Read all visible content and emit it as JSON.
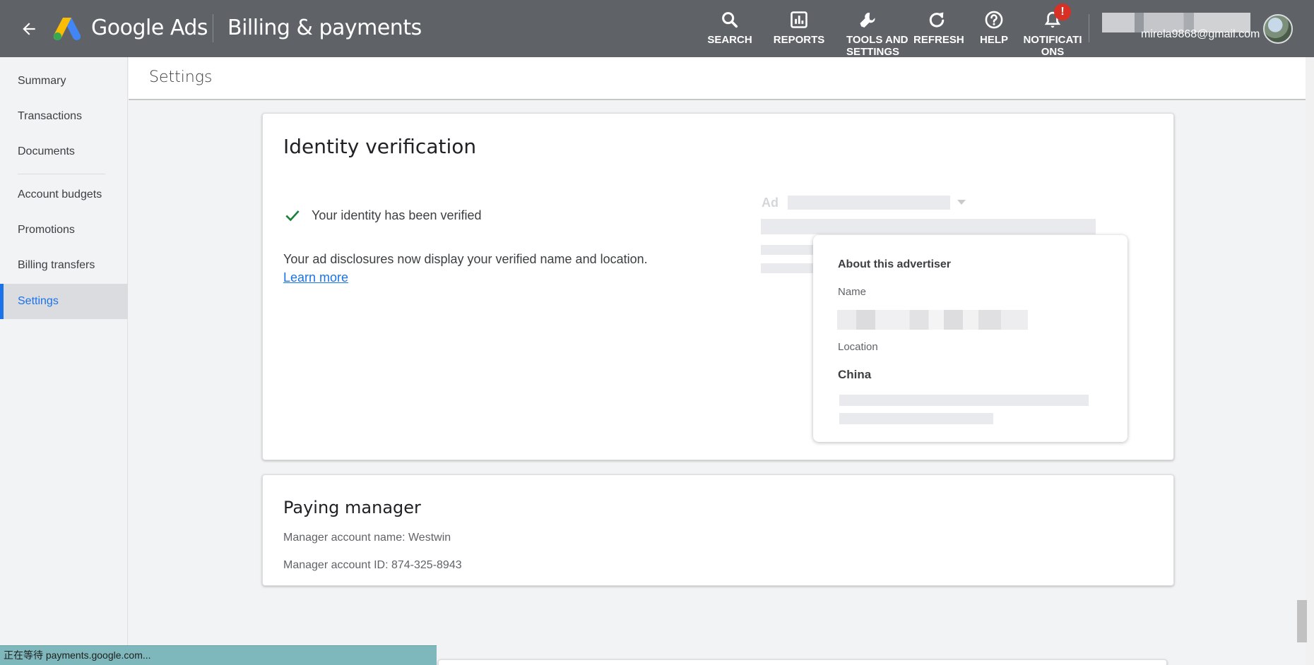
{
  "header": {
    "brand": "Google Ads",
    "section": "Billing & payments",
    "tools": [
      {
        "label": "SEARCH",
        "icon": "search-icon"
      },
      {
        "label": "REPORTS",
        "icon": "reports-icon"
      },
      {
        "label": "TOOLS AND SETTINGS",
        "icon": "wrench-icon"
      },
      {
        "label": "REFRESH",
        "icon": "refresh-icon"
      },
      {
        "label": "HELP",
        "icon": "help-icon"
      },
      {
        "label": "NOTIFICATIONS",
        "icon": "bell-icon"
      }
    ],
    "notification_badge": "!",
    "email": "mirela9868@gmail.com"
  },
  "sidebar": {
    "items": [
      {
        "label": "Summary"
      },
      {
        "label": "Transactions"
      },
      {
        "label": "Documents"
      },
      {
        "label": "Account budgets"
      },
      {
        "label": "Promotions"
      },
      {
        "label": "Billing transfers"
      },
      {
        "label": "Settings",
        "active": true
      }
    ]
  },
  "page": {
    "title": "Settings"
  },
  "identity": {
    "title": "Identity verification",
    "status": "Your identity has been verified",
    "description": "Your ad disclosures now display your verified name and location.",
    "learn_more": "Learn more",
    "ad_label": "Ad",
    "popup": {
      "title": "About this advertiser",
      "name_label": "Name",
      "location_label": "Location",
      "location_value": "China"
    }
  },
  "paying_manager": {
    "title": "Paying manager",
    "name_line": "Manager account name: Westwin",
    "id_line": "Manager account ID: 874-325-8943"
  },
  "status_bar": {
    "text": "正在等待 payments.google.com..."
  },
  "colors": {
    "header_bg": "#5f6368",
    "accent": "#1a73e8",
    "success": "#188038",
    "badge": "#d93025"
  }
}
